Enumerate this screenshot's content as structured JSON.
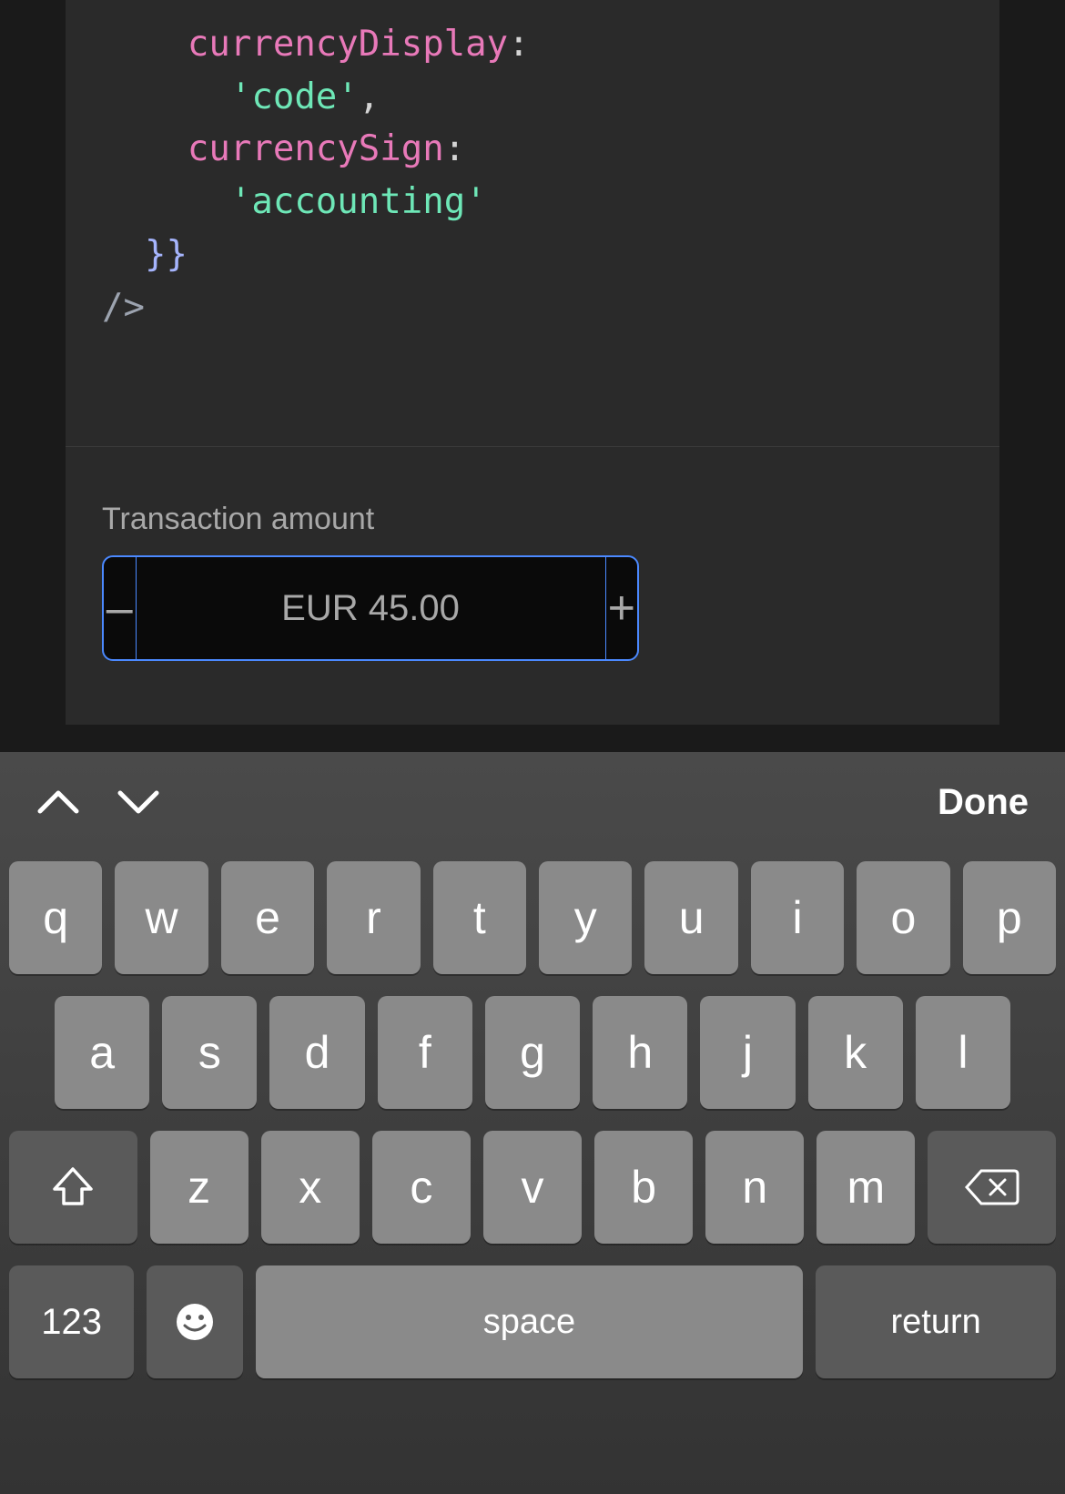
{
  "code": {
    "line1_prop": "currencyDisplay",
    "line1_colon": ":",
    "line2_string": "'code'",
    "line2_comma": ",",
    "line3_prop": "currencySign",
    "line3_colon": ":",
    "line4_string": "'accounting'",
    "line5_braces": "}}",
    "line6_close": "/>"
  },
  "preview": {
    "label": "Transaction amount",
    "value": "EUR 45.00",
    "minus": "–",
    "plus": "+"
  },
  "keyboard": {
    "done": "Done",
    "row1": [
      "q",
      "w",
      "e",
      "r",
      "t",
      "y",
      "u",
      "i",
      "o",
      "p"
    ],
    "row2": [
      "a",
      "s",
      "d",
      "f",
      "g",
      "h",
      "j",
      "k",
      "l"
    ],
    "row3": [
      "z",
      "x",
      "c",
      "v",
      "b",
      "n",
      "m"
    ],
    "num_label": "123",
    "space_label": "space",
    "return_label": "return"
  }
}
